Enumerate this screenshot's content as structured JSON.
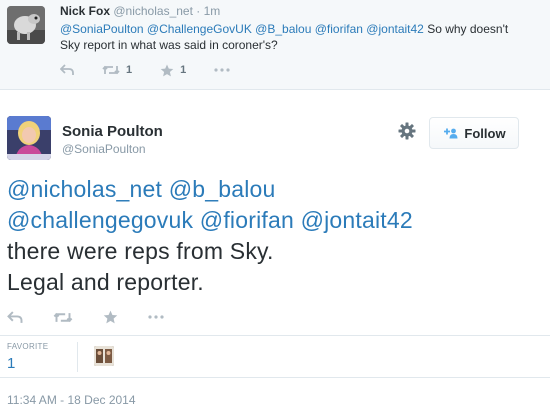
{
  "reply_tweet": {
    "fullname": "Nick Fox",
    "username": "@nicholas_net",
    "separator": "·",
    "time": "1m",
    "mentions": [
      "@SoniaPoulton",
      "@ChallengeGovUK",
      "@B_balou",
      "@fiorifan",
      "@jontait42"
    ],
    "text_rest": " So why doesn't Sky report in what was said in coroner's?",
    "retweet_count": "1",
    "favorite_count": "1",
    "icons": {
      "reply": "reply-icon",
      "retweet": "retweet-icon",
      "favorite": "star-icon",
      "more": "more-icon"
    }
  },
  "main_tweet": {
    "fullname": "Sonia Poulton",
    "username": "@SoniaPoulton",
    "follow_label": "Follow",
    "line1_mentions": [
      "@nicholas_net",
      "@b_balou"
    ],
    "line2_mentions": [
      "@challengegovuk",
      "@fiorifan",
      "@jontait42"
    ],
    "text_rest": "there were reps from Sky. Legal and reporter.",
    "stats": {
      "favorites_label": "FAVORITE",
      "favorites_count": "1"
    },
    "timestamp": "11:34 AM - 18 Dec 2014"
  },
  "colors": {
    "link": "#2b7bb9",
    "muted": "#8899a6",
    "text": "#292f33",
    "icon": "#b1bbc3"
  }
}
